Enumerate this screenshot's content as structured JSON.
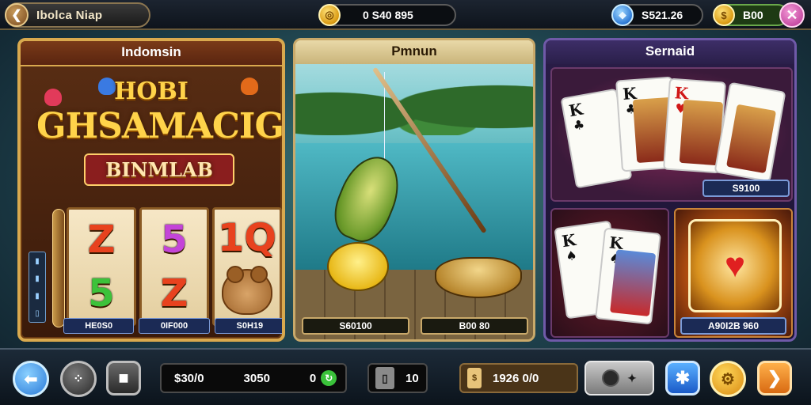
{
  "topbar": {
    "back_icon": "chevron-left-icon",
    "title": "Ibolca Niap",
    "coins_value": "0 S40 895",
    "gems_value": "S521.26",
    "gold_value": "B00",
    "close_icon": "close-icon"
  },
  "slot": {
    "title": "Indomsin",
    "logo_line1": "HOBI",
    "logo_line2": "GHSAMACIGA",
    "logo_line3": "BINMLAB",
    "reels": [
      {
        "top": "Z",
        "top_color": "#e8421e",
        "bottom": "5",
        "bottom_color": "#3cc23a"
      },
      {
        "top": "5",
        "top_color": "#c444d8",
        "bottom": "Z",
        "bottom_color": "#e8421e"
      },
      {
        "top": "1Q",
        "top_color": "#e8421e",
        "bottom": "bear",
        "bottom_color": "#b87a3a"
      }
    ],
    "values": [
      "HE0S0",
      "0IF000",
      "S0H19"
    ]
  },
  "fishing": {
    "title": "Pmnun",
    "values": [
      "S60100",
      "B00 80"
    ]
  },
  "cards": {
    "title": "Sernaid",
    "top_value": "S9100",
    "bottom_value": "A90I2B 960",
    "card_ranks": [
      "K",
      "K",
      "K",
      "K",
      "K"
    ],
    "heart_icon": "heart-icon"
  },
  "bottombar": {
    "balance_label": "$30/0",
    "balance_mid": "3050",
    "balance_right": "0",
    "level_value": "10",
    "ticket_value": "1926 0/0",
    "search_label": "",
    "buttons": [
      "back",
      "menu",
      "stop",
      "settings",
      "gear",
      "next"
    ]
  },
  "colors": {
    "accent_gold": "#d9a94e",
    "panel_purple": "#6f5aa8",
    "value_blue": "#1b2a55"
  }
}
